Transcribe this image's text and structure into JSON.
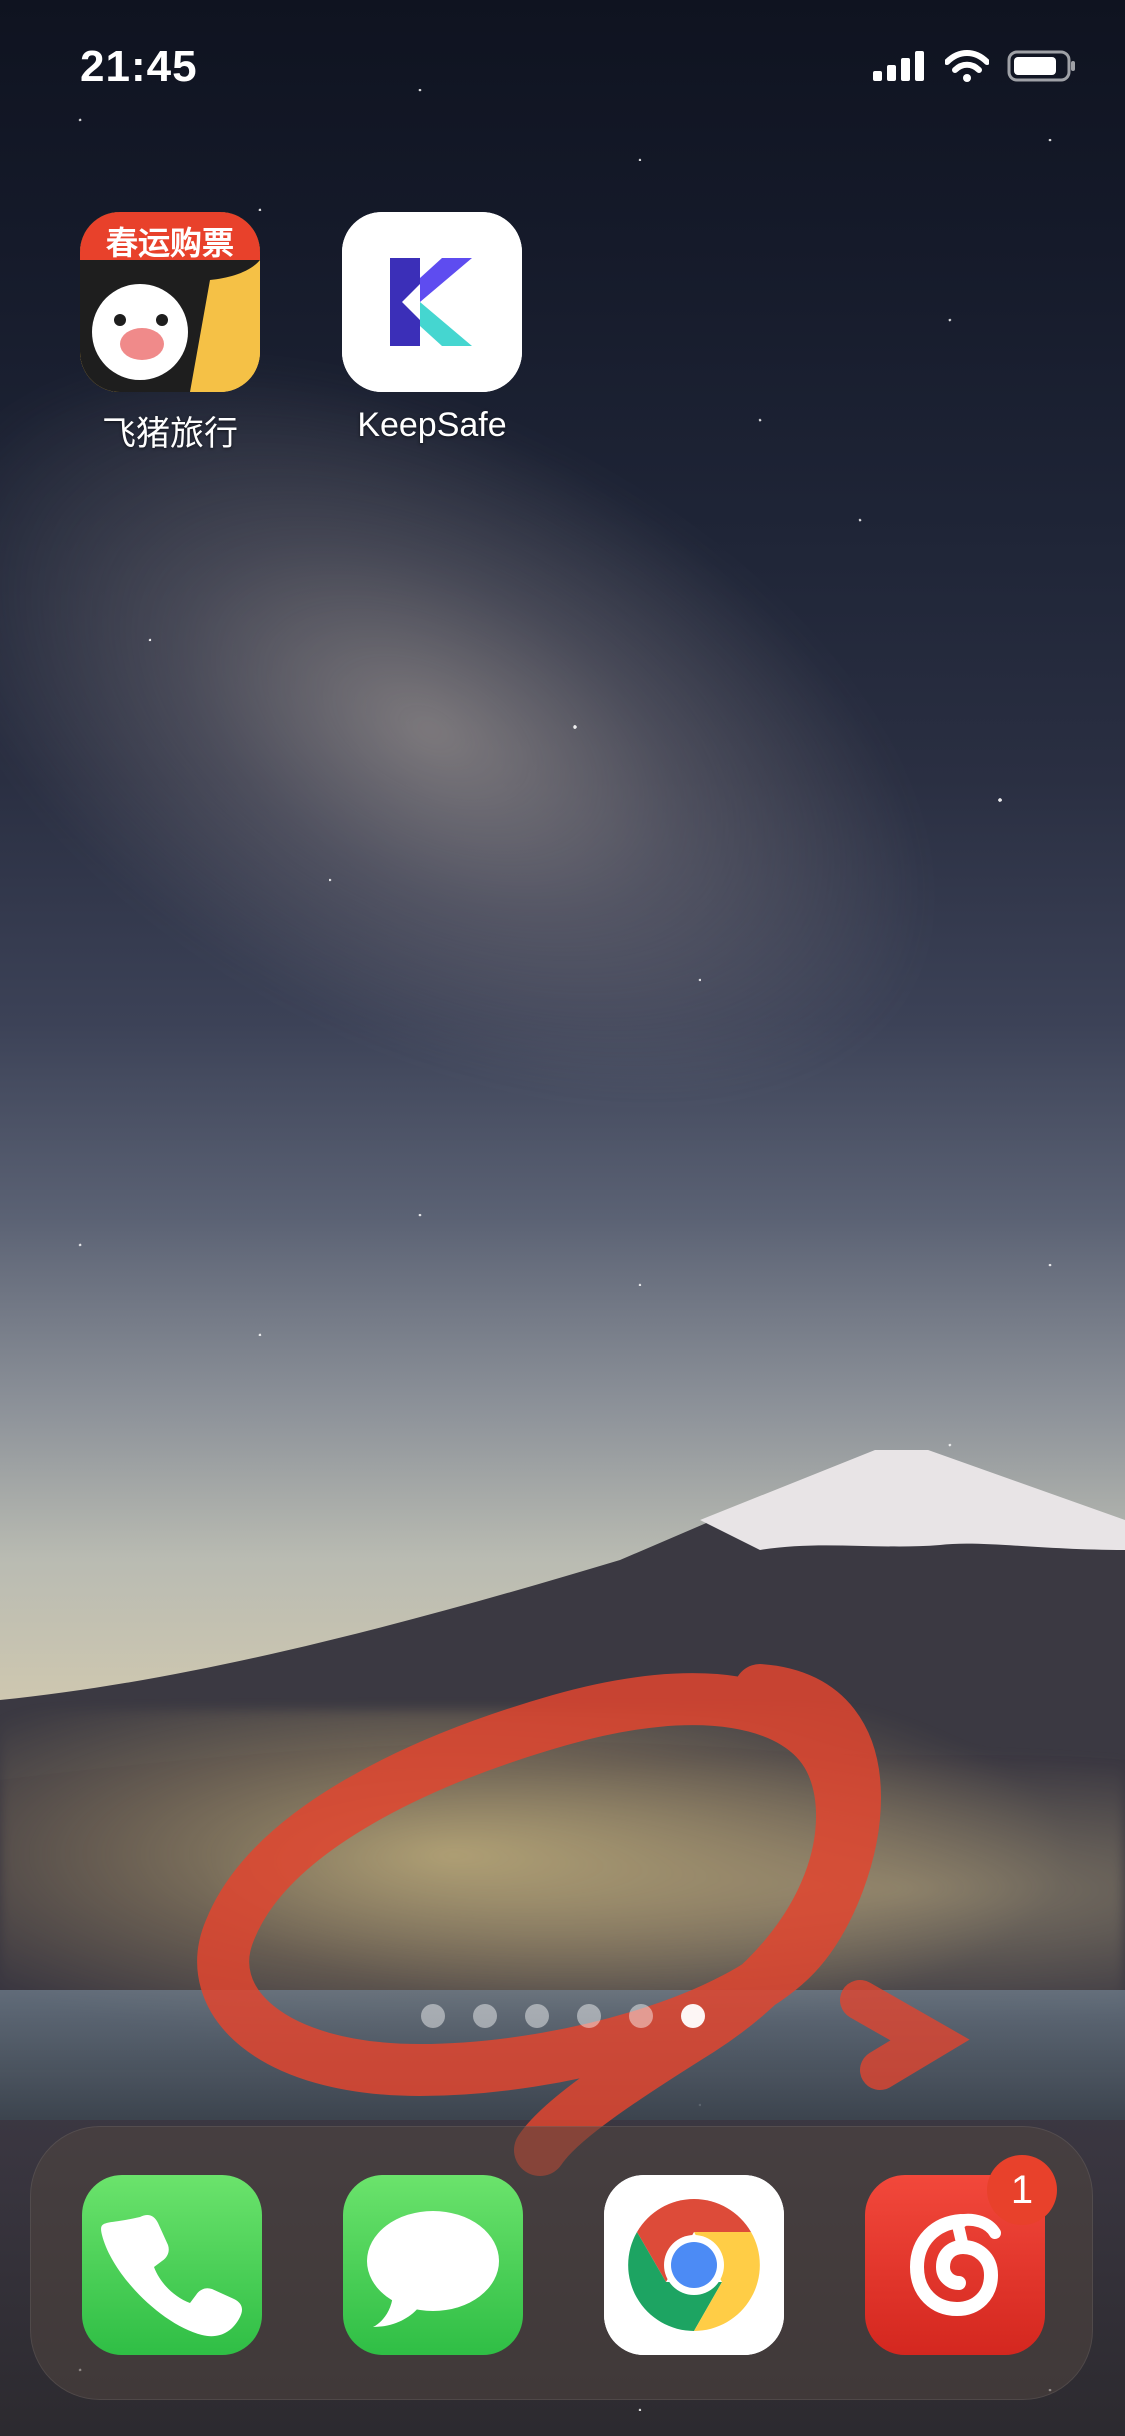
{
  "status_bar": {
    "time": "21:45",
    "icons": [
      "signal-icon",
      "wifi-icon",
      "battery-icon"
    ]
  },
  "home_apps": [
    {
      "label": "飞猪旅行",
      "icon_text": "春运购票",
      "icon": "fliggy-icon"
    },
    {
      "label": "KeepSafe",
      "icon": "keepsafe-icon"
    }
  ],
  "page_indicator": {
    "total": 6,
    "active_index": 5
  },
  "dock": {
    "apps": [
      {
        "name": "Phone",
        "icon": "phone-icon"
      },
      {
        "name": "Messages",
        "icon": "messages-icon"
      },
      {
        "name": "Chrome",
        "icon": "chrome-icon"
      },
      {
        "name": "NetEase Cloud Music",
        "icon": "netease-music-icon",
        "badge": "1"
      }
    ]
  },
  "colors": {
    "annotation_red": "#e0452f",
    "badge_red": "#e8412b",
    "green_app": "#4cd964",
    "netease_red": "#e3372d"
  }
}
